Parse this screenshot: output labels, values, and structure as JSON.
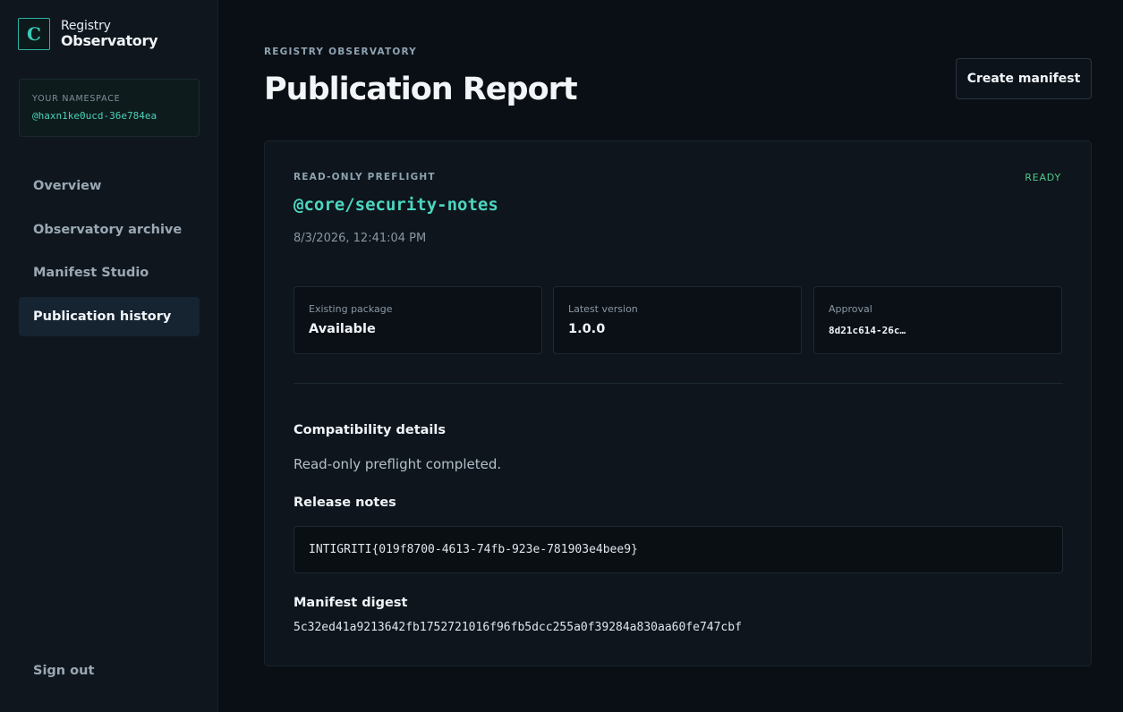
{
  "brand": {
    "logo_letter": "C",
    "top": "Registry",
    "bottom": "Observatory"
  },
  "namespace": {
    "label": "YOUR NAMESPACE",
    "value": "@haxn1ke0ucd-36e784ea"
  },
  "nav": {
    "items": [
      {
        "label": "Overview",
        "active": false
      },
      {
        "label": "Observatory archive",
        "active": false
      },
      {
        "label": "Manifest Studio",
        "active": false
      },
      {
        "label": "Publication history",
        "active": true
      }
    ],
    "sign_out": "Sign out"
  },
  "header": {
    "eyebrow": "REGISTRY OBSERVATORY",
    "title": "Publication Report",
    "create_button": "Create manifest"
  },
  "report": {
    "eyebrow": "READ-ONLY PREFLIGHT",
    "status": "READY",
    "status_color": "#4fc98a",
    "package": "@core/security-notes",
    "timestamp": "8/3/2026, 12:41:04 PM",
    "stats": [
      {
        "label": "Existing package",
        "value": "Available"
      },
      {
        "label": "Latest version",
        "value": "1.0.0"
      },
      {
        "label": "Approval",
        "value": "8d21c614-26c…"
      }
    ],
    "compatibility_title": "Compatibility details",
    "compatibility_text": "Read-only preflight completed.",
    "release_notes_title": "Release notes",
    "release_notes": "INTIGRITI{019f8700-4613-74fb-923e-781903e4bee9}",
    "digest_title": "Manifest digest",
    "digest": "5c32ed41a9213642fb1752721016f96fb5dcc255a0f39284a830aa60fe747cbf"
  },
  "colors": {
    "accent": "#4cd6c0",
    "background": "#0a0f15",
    "sidebar": "#0f161e"
  }
}
